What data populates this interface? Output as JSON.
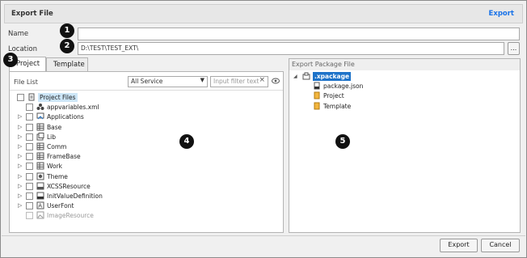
{
  "dialog": {
    "title": "Export File",
    "header_link": "Export"
  },
  "name": {
    "label": "Name",
    "value": ""
  },
  "location": {
    "label": "Location",
    "value": "D:\\TEST\\TEST_EXT\\",
    "browse_label": "..."
  },
  "tabs": [
    {
      "label": "Project",
      "active": true
    },
    {
      "label": "Template",
      "active": false
    }
  ],
  "file_list": {
    "header": "File List",
    "service_select": "All Service",
    "filter_placeholder": "Input filter text",
    "clear_icon": "×",
    "items": [
      {
        "label": "Project Files",
        "icon": "doc-icon",
        "expander": "",
        "selected": true,
        "disabled": false
      },
      {
        "label": "appvariables.xml",
        "icon": "variables-icon",
        "expander": "",
        "selected": false,
        "disabled": false
      },
      {
        "label": "Applications",
        "icon": "application-icon",
        "expander": "▷",
        "selected": false,
        "disabled": false
      },
      {
        "label": "Base",
        "icon": "grid-icon",
        "expander": "▷",
        "selected": false,
        "disabled": false
      },
      {
        "label": "Lib",
        "icon": "lib-icon",
        "expander": "▷",
        "selected": false,
        "disabled": false
      },
      {
        "label": "Comm",
        "icon": "grid-icon",
        "expander": "▷",
        "selected": false,
        "disabled": false
      },
      {
        "label": "FrameBase",
        "icon": "grid-icon",
        "expander": "▷",
        "selected": false,
        "disabled": false
      },
      {
        "label": "Work",
        "icon": "grid-icon",
        "expander": "▷",
        "selected": false,
        "disabled": false
      },
      {
        "label": "Theme",
        "icon": "theme-icon",
        "expander": "▷",
        "selected": false,
        "disabled": false
      },
      {
        "label": "XCSSResource",
        "icon": "css-icon",
        "expander": "▷",
        "selected": false,
        "disabled": false
      },
      {
        "label": "InitValueDefinition",
        "icon": "init-icon",
        "expander": "▷",
        "selected": false,
        "disabled": false
      },
      {
        "label": "UserFont",
        "icon": "font-icon",
        "expander": "▷",
        "selected": false,
        "disabled": false
      },
      {
        "label": "ImageResource",
        "icon": "image-icon",
        "expander": "",
        "selected": false,
        "disabled": true
      }
    ]
  },
  "export_package": {
    "header": "Export Package File",
    "items": [
      {
        "label": ".xpackage",
        "icon": "package-icon",
        "expander": "◢",
        "level": 0,
        "selected": true
      },
      {
        "label": "package.json",
        "icon": "json-icon",
        "expander": "",
        "level": 1,
        "selected": false
      },
      {
        "label": "Project",
        "icon": "project-icon",
        "expander": "",
        "level": 1,
        "selected": false
      },
      {
        "label": "Template",
        "icon": "template-icon",
        "expander": "",
        "level": 1,
        "selected": false
      }
    ]
  },
  "badges": [
    "1",
    "2",
    "3",
    "4",
    "5"
  ],
  "footer": {
    "export_label": "Export",
    "cancel_label": "Cancel"
  },
  "colors": {
    "accent": "#1a73e8",
    "selection": "#1e73c9",
    "badge": "#111111"
  }
}
